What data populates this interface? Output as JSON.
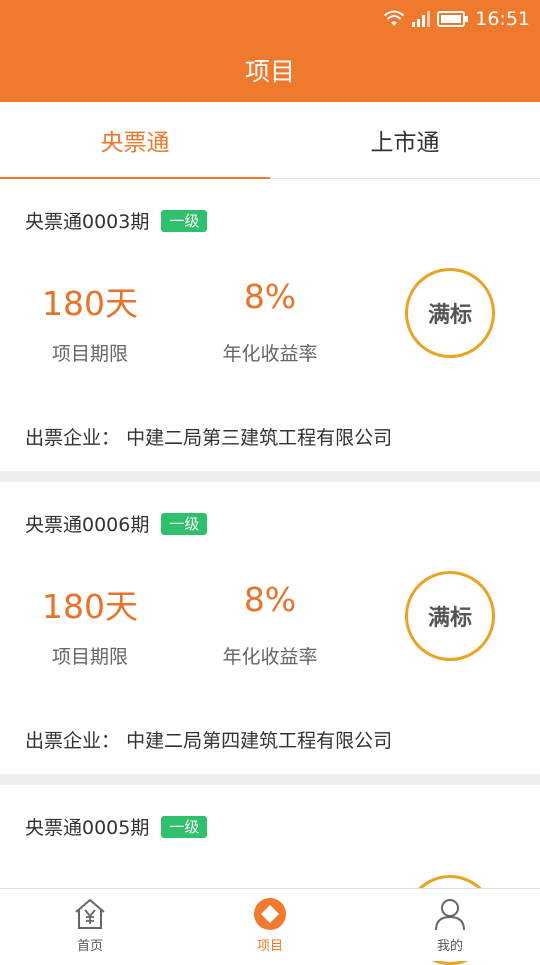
{
  "status_bar": {
    "time": "16:51"
  },
  "header": {
    "title": "项目"
  },
  "tabs": [
    {
      "label": "央票通",
      "active": true
    },
    {
      "label": "上市通",
      "active": false
    }
  ],
  "projects": [
    {
      "name": "央票通0003期",
      "level": "一级",
      "term_value": "180天",
      "term_label": "项目期限",
      "rate_value": "8%",
      "rate_label": "年化收益率",
      "status": "满标",
      "issuer_label": "出票企业：",
      "issuer": "中建二局第三建筑工程有限公司"
    },
    {
      "name": "央票通0006期",
      "level": "一级",
      "term_value": "180天",
      "term_label": "项目期限",
      "rate_value": "8%",
      "rate_label": "年化收益率",
      "status": "满标",
      "issuer_label": "出票企业：",
      "issuer": "中建二局第四建筑工程有限公司"
    },
    {
      "name": "央票通0005期",
      "level": "一级"
    }
  ],
  "bottom_nav": [
    {
      "label": "首页",
      "icon": "home-yen-icon"
    },
    {
      "label": "项目",
      "icon": "project-diamond-icon",
      "active": true
    },
    {
      "label": "我的",
      "icon": "person-icon"
    }
  ],
  "colors": {
    "accent": "#ef7a2d",
    "value_orange": "#e8732a",
    "badge_green": "#2ec06b",
    "circle_gold": "#e8a422"
  }
}
